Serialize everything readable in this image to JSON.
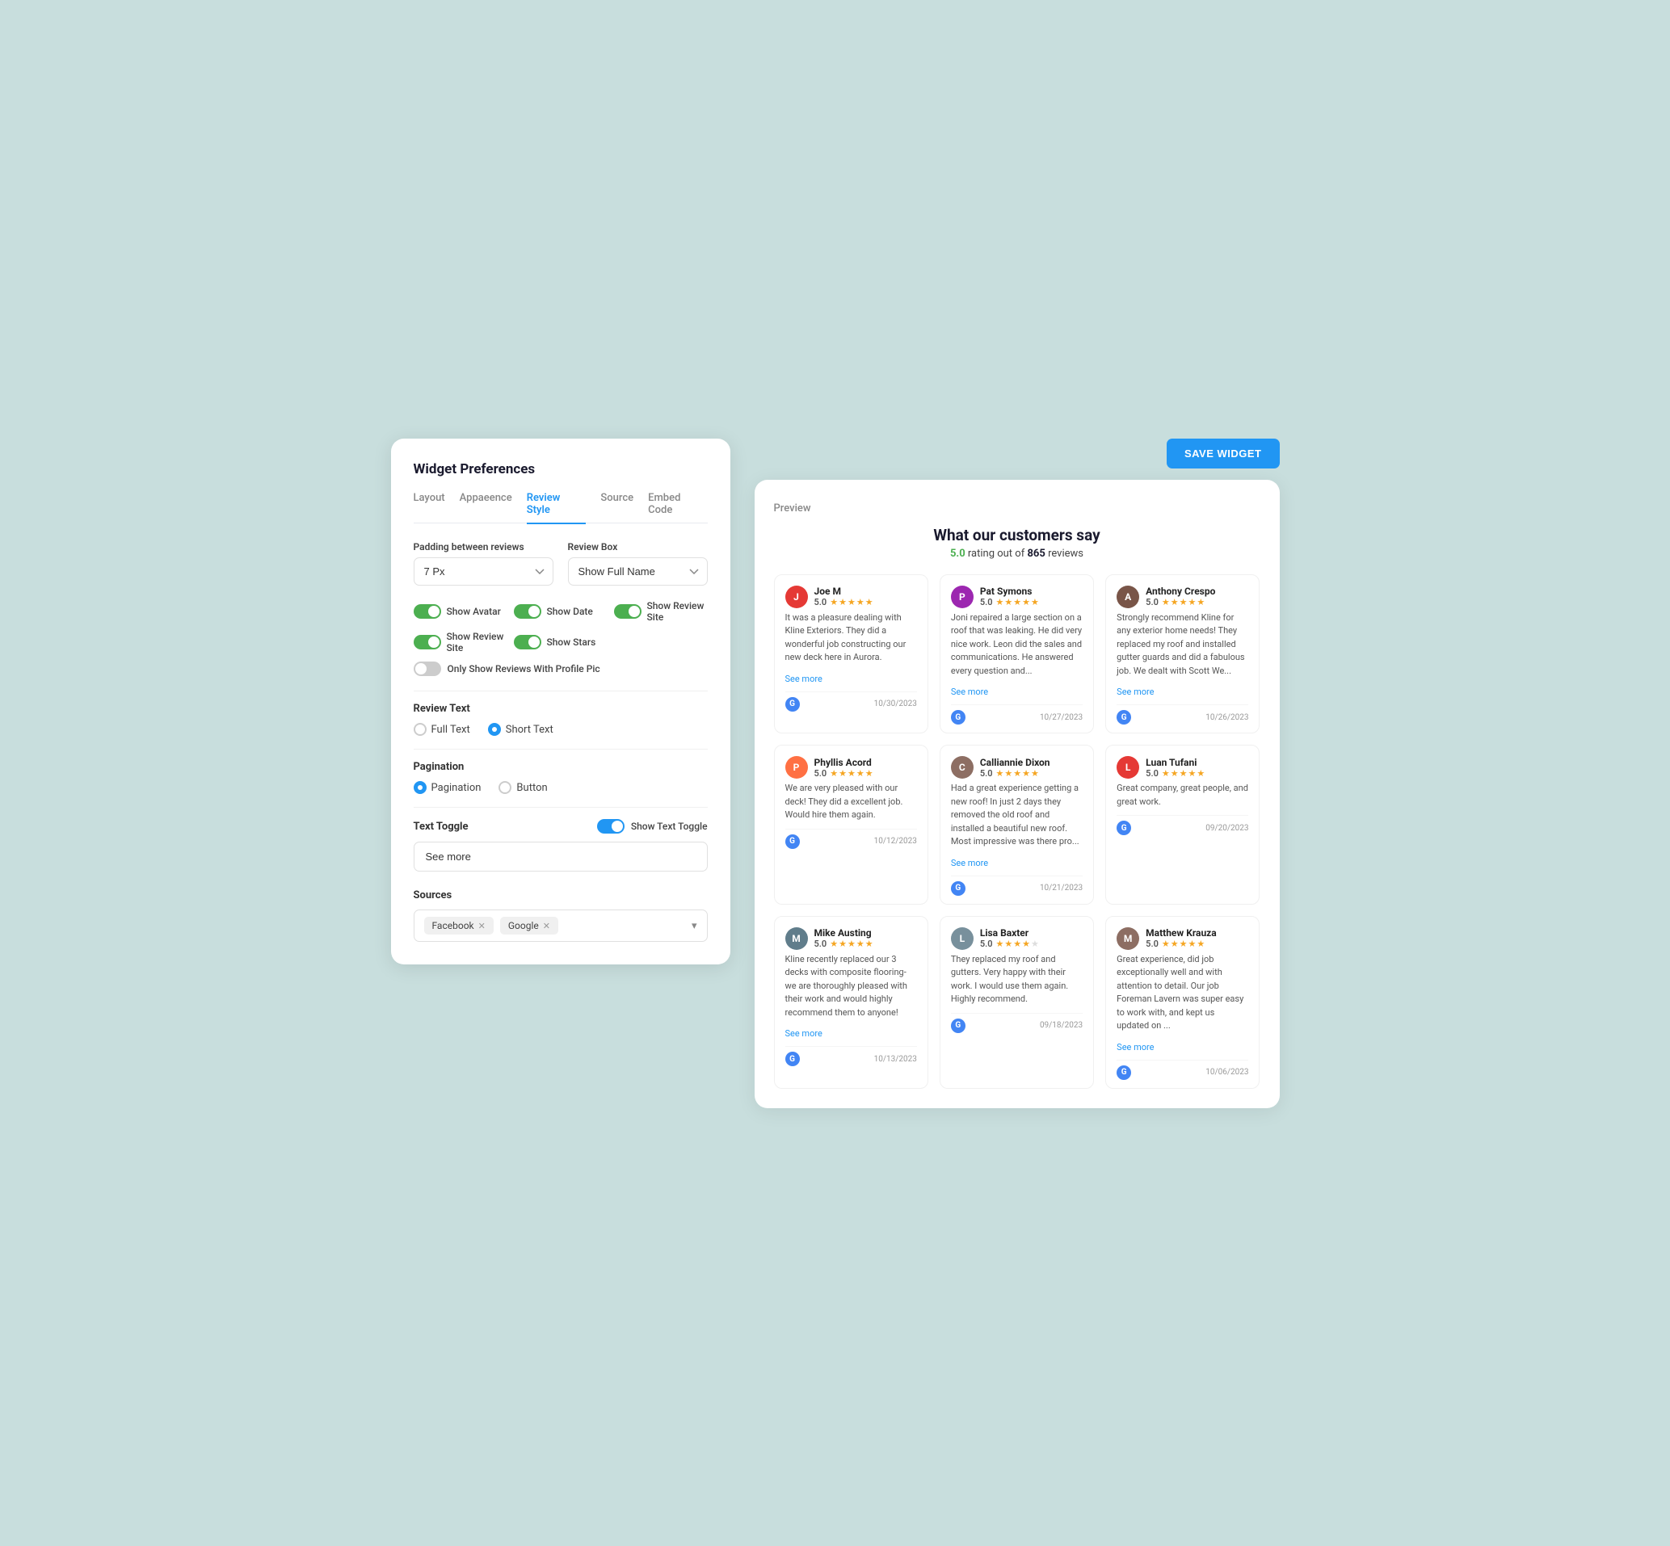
{
  "leftPanel": {
    "title": "Widget Preferences",
    "tabs": [
      {
        "label": "Layout",
        "active": false
      },
      {
        "label": "Appaeence",
        "active": false
      },
      {
        "label": "Review Style",
        "active": true
      },
      {
        "label": "Source",
        "active": false
      },
      {
        "label": "Embed Code",
        "active": false
      }
    ],
    "paddingLabel": "Padding between reviews",
    "paddingValue": "7 Px",
    "reviewBoxLabel": "Review Box",
    "reviewBoxValue": "Show Full Name",
    "toggles": [
      {
        "label": "Show Avatar",
        "on": true,
        "color": "green"
      },
      {
        "label": "Show Date",
        "on": true,
        "color": "green"
      },
      {
        "label": "Show Review Site",
        "on": true,
        "color": "green"
      },
      {
        "label": "Show Review Site",
        "on": true,
        "color": "green"
      },
      {
        "label": "Show Stars",
        "on": true,
        "color": "green"
      }
    ],
    "onlyProfileLabel": "Only Show Reviews With Profile Pic",
    "reviewTextLabel": "Review Text",
    "radioOptions": [
      {
        "label": "Full Text",
        "selected": false
      },
      {
        "label": "Short Text",
        "selected": true
      }
    ],
    "paginationLabel": "Pagination",
    "paginationOptions": [
      {
        "label": "Pagination",
        "selected": true
      },
      {
        "label": "Button",
        "selected": false
      }
    ],
    "textToggleLabel": "Text Toggle",
    "showTextToggleLabel": "Show Text Toggle",
    "seeMoreValue": "See more",
    "sourcesLabel": "Sources",
    "sources": [
      "Facebook",
      "Google"
    ]
  },
  "rightPanel": {
    "saveLabel": "SAVE WIDGET",
    "previewLabel": "Preview",
    "widgetTitle": "What our customers say",
    "ratingText": "rating out of",
    "ratingValue": "5.0",
    "reviewCount": "865",
    "reviewsLabel": "reviews",
    "reviews": [
      {
        "name": "Joe M",
        "rating": "5.0",
        "stars": 5,
        "text": "It was a pleasure dealing with Kline Exteriors. They did a wonderful job constructing our new deck here in Aurora.",
        "hasSeeMore": true,
        "date": "10/30/2023",
        "avatarColor": "#e53935",
        "avatarInitial": "J"
      },
      {
        "name": "Pat Symons",
        "rating": "5.0",
        "stars": 5,
        "text": "Joni repaired a large section on a roof that was leaking. He did very nice work. Leon did the sales and communications. He answered every question and...",
        "hasSeeMore": true,
        "date": "10/27/2023",
        "avatarColor": "#9c27b0",
        "avatarInitial": "P"
      },
      {
        "name": "Anthony Crespo",
        "rating": "5.0",
        "stars": 5,
        "text": "Strongly recommend Kline for any exterior home needs! They replaced my roof and installed gutter guards and did a fabulous job. We dealt with Scott We...",
        "hasSeeMore": true,
        "date": "10/26/2023",
        "avatarColor": "#795548",
        "avatarInitial": "A",
        "hasPhoto": true
      },
      {
        "name": "Phyllis Acord",
        "rating": "5.0",
        "stars": 5,
        "text": "We are very pleased with our deck! They did a excellent job. Would hire them again.",
        "hasSeeMore": false,
        "date": "10/12/2023",
        "avatarColor": "#ff7043",
        "avatarInitial": "P"
      },
      {
        "name": "Calliannie Dixon",
        "rating": "5.0",
        "stars": 5,
        "text": "Had a great experience getting a new roof! In just 2 days they removed the old roof and installed a beautiful new roof. Most impressive was there pro...",
        "hasSeeMore": true,
        "date": "10/21/2023",
        "avatarColor": "#8d6e63",
        "avatarInitial": "C",
        "hasPhoto": true
      },
      {
        "name": "Luan Tufani",
        "rating": "5.0",
        "stars": 5,
        "text": "Great company, great people, and great work.",
        "hasSeeMore": false,
        "date": "09/20/2023",
        "avatarColor": "#e53935",
        "avatarInitial": "L"
      },
      {
        "name": "Mike Austing",
        "rating": "5.0",
        "stars": 5,
        "text": "Kline recently replaced our 3 decks with composite flooring-we are thoroughly pleased with their work and would highly recommend them to anyone!",
        "hasSeeMore": true,
        "date": "10/13/2023",
        "avatarColor": "#607d8b",
        "avatarInitial": "M",
        "hasPhoto": true
      },
      {
        "name": "Lisa Baxter",
        "rating": "5.0",
        "stars": 4,
        "text": "They replaced my roof and gutters. Very happy with their work. I would use them again. Highly recommend.",
        "hasSeeMore": false,
        "date": "09/18/2023",
        "avatarColor": "#78909c",
        "avatarInitial": "L",
        "hasPhoto": true
      },
      {
        "name": "Matthew Krauza",
        "rating": "5.0",
        "stars": 5,
        "text": "Great experience, did job exceptionally well and with attention to detail. Our job Foreman Lavern was super easy to work with, and kept us updated on ...",
        "hasSeeMore": true,
        "date": "10/06/2023",
        "avatarColor": "#8d6e63",
        "avatarInitial": "M",
        "hasPhoto": true
      }
    ]
  }
}
